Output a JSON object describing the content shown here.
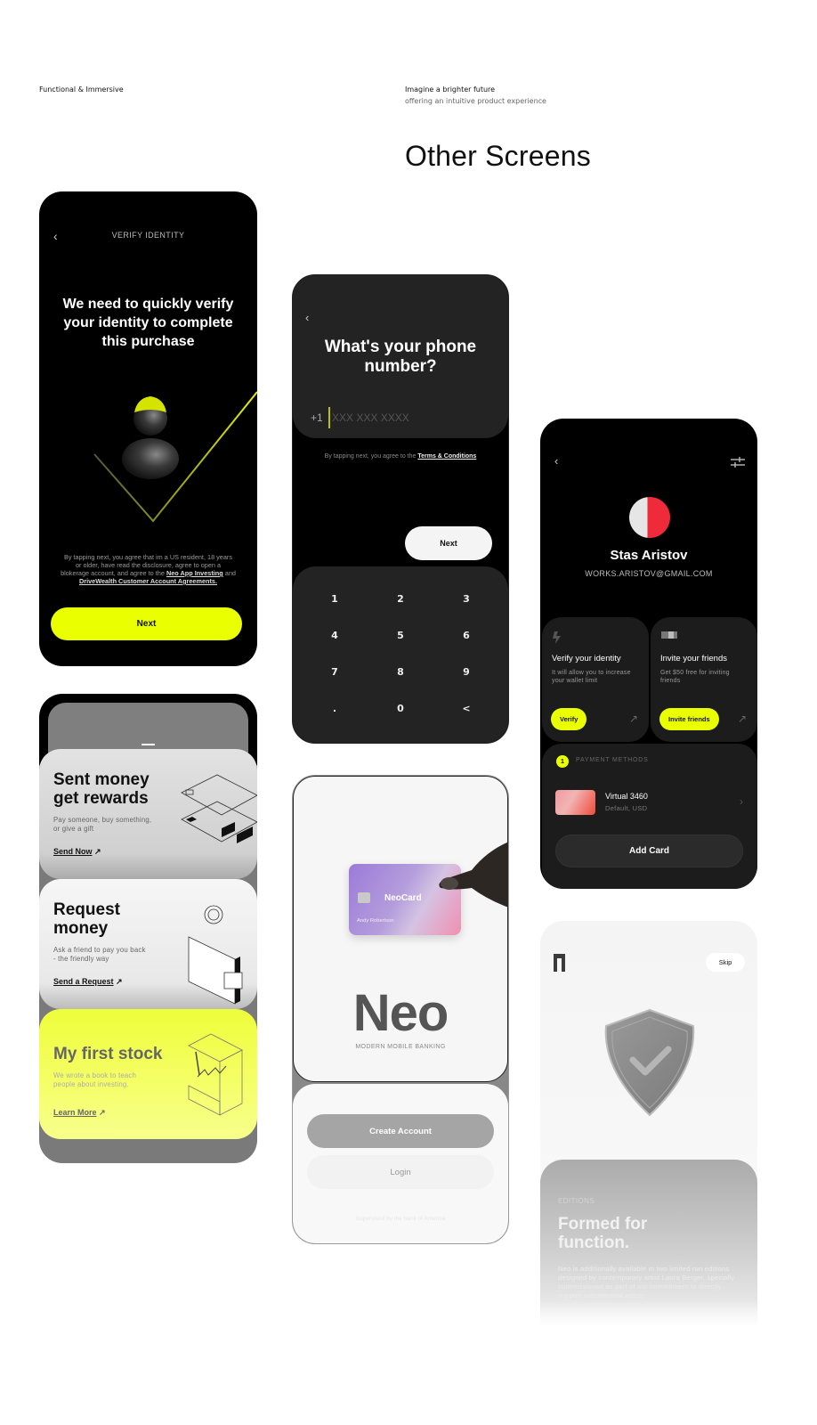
{
  "header": {
    "left_label": "Functional & Immersive",
    "right_label": "Imagine a brighter future",
    "right_sub": "offering an intuitive product experience",
    "section_title": "Other Screens"
  },
  "colors": {
    "accent": "#eaff00",
    "dark_bg": "#000000",
    "panel": "#232323"
  },
  "verify_screen": {
    "back_icon": "chevron-left-icon",
    "nav_title": "VERIFY IDENTITY",
    "headline": "We need to quickly verify your identity to complete this purchase",
    "legal_prefix": "By tapping next, you agree that im a US resident, 18 years or older, have read the disclosure, agree to open a blokerage account, and agree to the ",
    "legal_link1": "Neo App Investing",
    "legal_and": " and ",
    "legal_link2": "DriveWealth Customer Account Agreements.",
    "next_label": "Next"
  },
  "phone_screen": {
    "title": "What's your phone number?",
    "country_code": "+1",
    "phone_placeholder": "XXX XXX XXXX",
    "terms_prefix": "By tapping next, you agree to the ",
    "terms_link": "Terms & Conditions",
    "next_label": "Next",
    "keypad": [
      "1",
      "2",
      "3",
      "4",
      "5",
      "6",
      "7",
      "8",
      "9",
      ".",
      "0",
      "<"
    ]
  },
  "profile_screen": {
    "name": "Stas Aristov",
    "email": "WORKS.ARISTOV@GMAIL.COM",
    "cards": [
      {
        "icon": "lightning-icon",
        "title": "Verify your identity",
        "desc": "It will allow you to increase your wallet limit",
        "button": "Verify"
      },
      {
        "icon": "card-icon",
        "title": "Invite your friends",
        "desc": "Get $50 free for inviting friends",
        "button": "Invite friends"
      }
    ],
    "payment": {
      "count": "1",
      "label": "PAYMENT METHODS",
      "card_name": "Virtual 3460",
      "card_sub": "Default, USD",
      "add_label": "Add Card"
    }
  },
  "feature_cards": [
    {
      "title_line1": "Sent money",
      "title_line2": "get rewards",
      "desc_line1": "Pay someone, buy something,",
      "desc_line2": "or give a gift",
      "link": "Send Now"
    },
    {
      "title_line1": "Request",
      "title_line2": "money",
      "desc_line1": "Ask a friend to pay you back",
      "desc_line2": "- the friendly way",
      "link": "Send a Request"
    },
    {
      "title_line1": "My first stock",
      "title_line2": "",
      "desc_line1": "We wrote a book to teach",
      "desc_line2": "people about investing.",
      "link": "Learn More"
    }
  ],
  "neo_screen": {
    "card_brand": "NeoCard",
    "card_holder": "Andy Robertson",
    "logo": "Neo",
    "tagline": "MODERN MOBILE BANKING",
    "create_label": "Create Account",
    "login_label": "Login",
    "supervised": "Supervised by the bank of America"
  },
  "onboarding_screen": {
    "skip_label": "Skip",
    "eyebrow": "EDITIONS",
    "title_line1": "Formed for",
    "title_line2": "function.",
    "body": "Neo is additionally available in two limited run editions designed by contemporary artist Laura Berger, specially commissioned as part of our commitment to directly support independent artists."
  }
}
